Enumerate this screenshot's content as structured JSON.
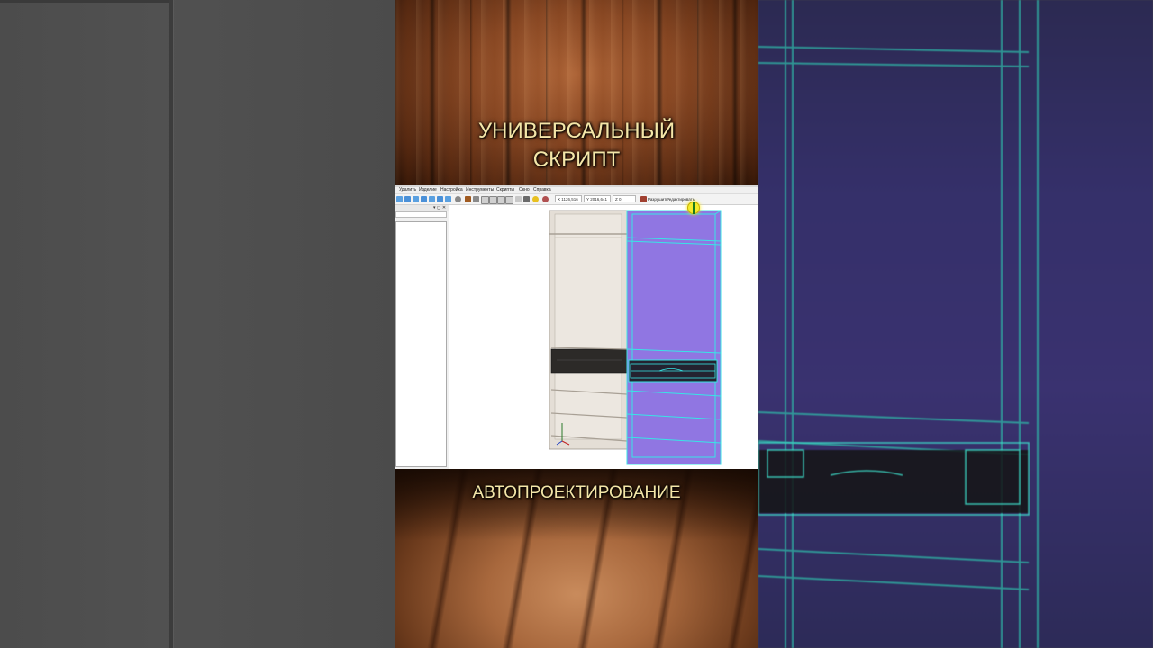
{
  "captions": {
    "top_line1": "УНИВЕРСАЛЬНЫЙ",
    "top_line2": "СКРИПТ",
    "bottom": "АВТОПРОЕКТИРОВАНИЕ"
  },
  "app": {
    "menu": [
      "Удалить",
      "Изделие",
      "Настройка",
      "Инструменты",
      "Скрипты",
      "Окно",
      "Справка"
    ],
    "coords": {
      "x_label": "X",
      "x_value": "1126,516",
      "y_label": "Y",
      "y_value": "2016,641",
      "z_label": "Z",
      "z_value": "0"
    },
    "actions": {
      "break": "Разрушить",
      "edit": "Редактировать"
    },
    "panel_controls": "▾ ◻ ✕"
  },
  "colors": {
    "caption": "#f4e6a8",
    "highlight_fill": "#8a6fe0",
    "highlight_edge": "#37e6e6",
    "cabinet_panel": "#e6e1da",
    "drawer": "#2c2a28"
  }
}
